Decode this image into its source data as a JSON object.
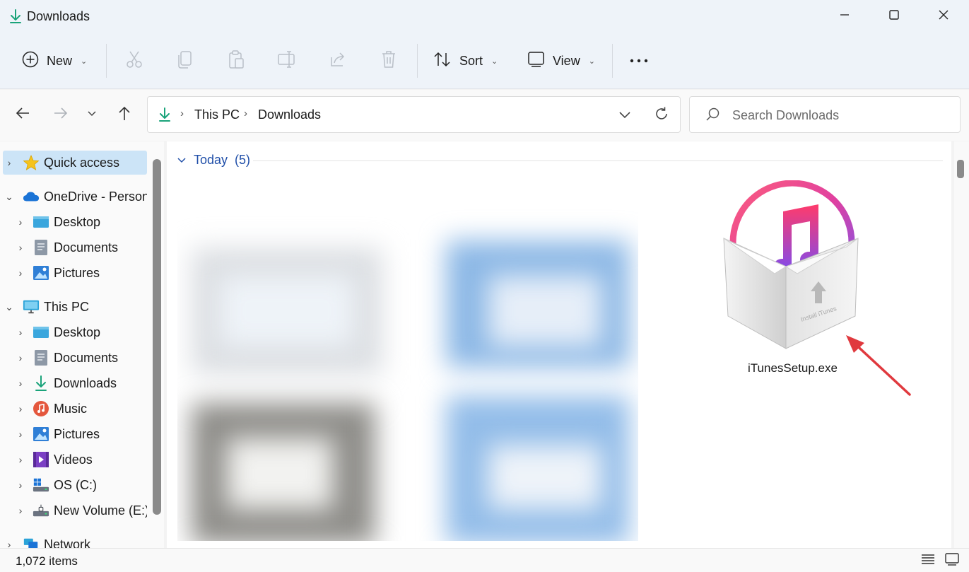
{
  "window": {
    "title": "Downloads",
    "controls": {
      "minimize": "minimize-icon",
      "maximize": "maximize-icon",
      "close": "close-icon"
    }
  },
  "commandbar": {
    "new_label": "New",
    "sort_label": "Sort",
    "view_label": "View",
    "icons": [
      "plus-circle-icon",
      "cut-icon",
      "copy-icon",
      "paste-icon",
      "rename-icon",
      "share-icon",
      "delete-icon",
      "sort-icon",
      "view-icon",
      "more-icon"
    ]
  },
  "address": {
    "crumbs": [
      "This PC",
      "Downloads"
    ],
    "search_placeholder": "Search Downloads"
  },
  "sidebar": {
    "items": [
      {
        "label": "Quick access",
        "icon": "star-icon",
        "level": 0,
        "selected": true
      },
      {
        "label": "OneDrive - Personal",
        "icon": "cloud-icon",
        "level": 0,
        "expanded": true
      },
      {
        "label": "Desktop",
        "icon": "desktop-folder-icon",
        "level": 1
      },
      {
        "label": "Documents",
        "icon": "documents-folder-icon",
        "level": 1
      },
      {
        "label": "Pictures",
        "icon": "pictures-folder-icon",
        "level": 1
      },
      {
        "label": "This PC",
        "icon": "monitor-icon",
        "level": 0,
        "expanded": true
      },
      {
        "label": "Desktop",
        "icon": "desktop-folder-icon",
        "level": 1
      },
      {
        "label": "Documents",
        "icon": "documents-folder-icon",
        "level": 1
      },
      {
        "label": "Downloads",
        "icon": "download-arrow-icon",
        "level": 1
      },
      {
        "label": "Music",
        "icon": "music-icon",
        "level": 1
      },
      {
        "label": "Pictures",
        "icon": "pictures-folder-icon",
        "level": 1
      },
      {
        "label": "Videos",
        "icon": "video-icon",
        "level": 1
      },
      {
        "label": "OS (C:)",
        "icon": "windows-drive-icon",
        "level": 1
      },
      {
        "label": "New Volume (E:)",
        "icon": "drive-icon",
        "level": 1
      },
      {
        "label": "Network",
        "icon": "network-icon",
        "level": 0
      }
    ]
  },
  "content": {
    "group_label": "Today",
    "group_count": "(5)",
    "file_name": "iTunesSetup.exe",
    "installer_text": "Install iTunes"
  },
  "statusbar": {
    "item_count": "1,072 items"
  },
  "colors": {
    "accent": "#0067c0",
    "selection": "#cce4f7",
    "group_header": "#1f4ea8",
    "download_green": "#1aa37a",
    "annotation_arrow": "#e0393e"
  }
}
